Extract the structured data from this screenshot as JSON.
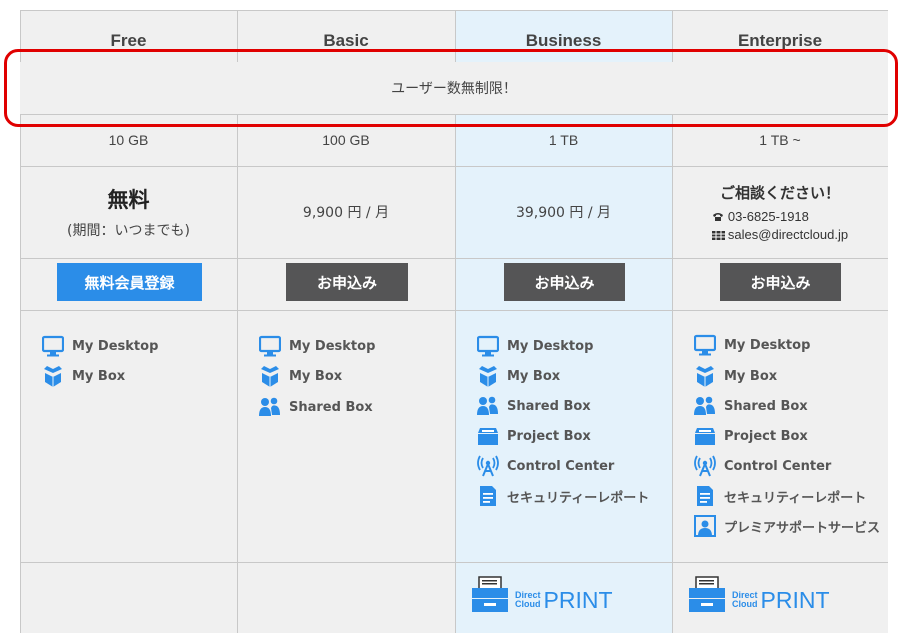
{
  "plans": [
    {
      "name": "Free",
      "storage": "10 GB"
    },
    {
      "name": "Basic",
      "storage": "100 GB"
    },
    {
      "name": "Business",
      "storage": "1 TB"
    },
    {
      "name": "Enterprise",
      "storage": "1 TB ~"
    }
  ],
  "banner": "ユーザー数無制限！",
  "pricing": {
    "free_main": "無料",
    "free_sub": "(期間：いつまでも)",
    "basic": "9,900 円 / 月",
    "business": "39,900 円 / 月",
    "enterprise_title": "ご相談ください！",
    "enterprise_phone": "03-6825-1918",
    "enterprise_email": "sales@directcloud.jp"
  },
  "buttons": {
    "free": "無料会員登録",
    "basic": "お申込み",
    "business": "お申込み",
    "enterprise": "お申込み"
  },
  "features": {
    "my_desktop": "My Desktop",
    "my_box": "My Box",
    "shared_box": "Shared Box",
    "project_box": "Project Box",
    "control_center": "Control Center",
    "security_report": "セキュリティーレポート",
    "premium_support": "プレミアサポートサービス"
  },
  "print_logo": {
    "line1": "Direct",
    "line2": "Cloud",
    "word": "PRINT"
  },
  "colors": {
    "accent": "#2b8de8",
    "highlight_column": "#e4f2fb",
    "table_bg": "#f0f0f0",
    "button_dark": "#555556",
    "outline_red": "#e00000"
  },
  "icons": [
    "monitor-icon",
    "box-icon",
    "users-icon",
    "project-box-icon",
    "antenna-icon",
    "report-icon",
    "support-icon",
    "phone-icon",
    "email-icon",
    "printer-icon"
  ]
}
